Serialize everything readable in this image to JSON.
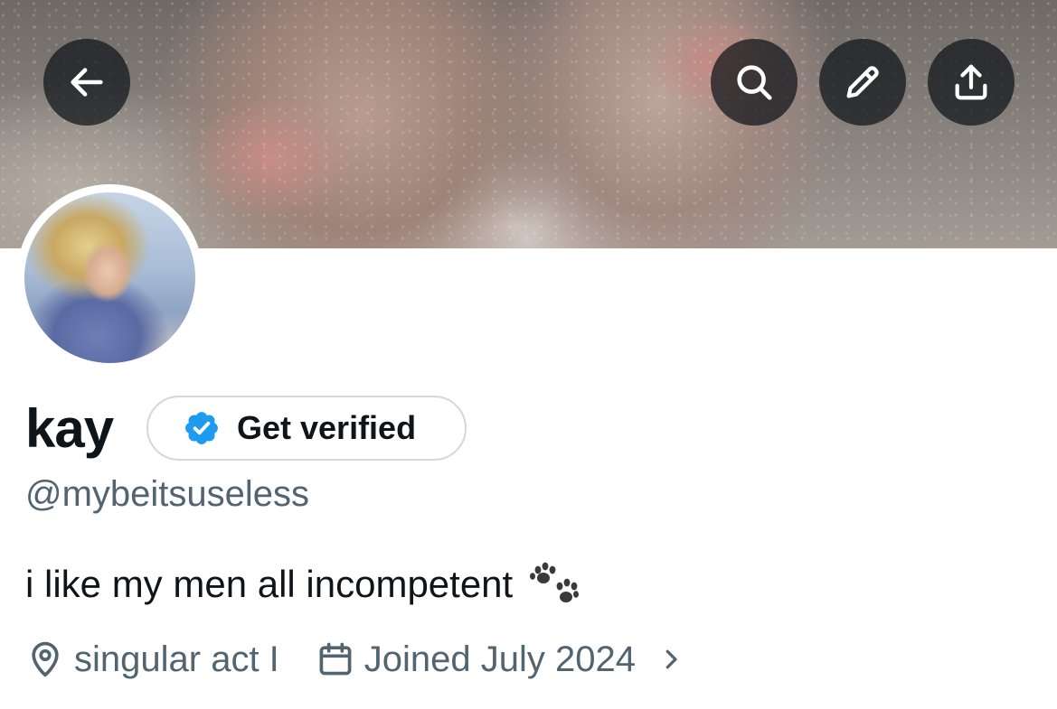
{
  "header": {
    "back_icon": "arrow-left-icon",
    "actions": [
      {
        "name": "search",
        "icon": "search-icon"
      },
      {
        "name": "edit",
        "icon": "pencil-icon"
      },
      {
        "name": "share",
        "icon": "share-upload-icon"
      }
    ]
  },
  "profile": {
    "display_name": "kay",
    "get_verified_label": "Get verified",
    "handle": "@mybeitsuseless",
    "bio": "i like my men all incompetent",
    "bio_emoji_icon": "paw-prints-icon",
    "location": "singular act I",
    "joined": "Joined July 2024"
  },
  "colors": {
    "text_primary": "#0f1419",
    "text_secondary": "#536471",
    "verified_blue": "#1d9bf0",
    "button_border": "#cfd9de",
    "overlay_button": "#0f1419"
  }
}
